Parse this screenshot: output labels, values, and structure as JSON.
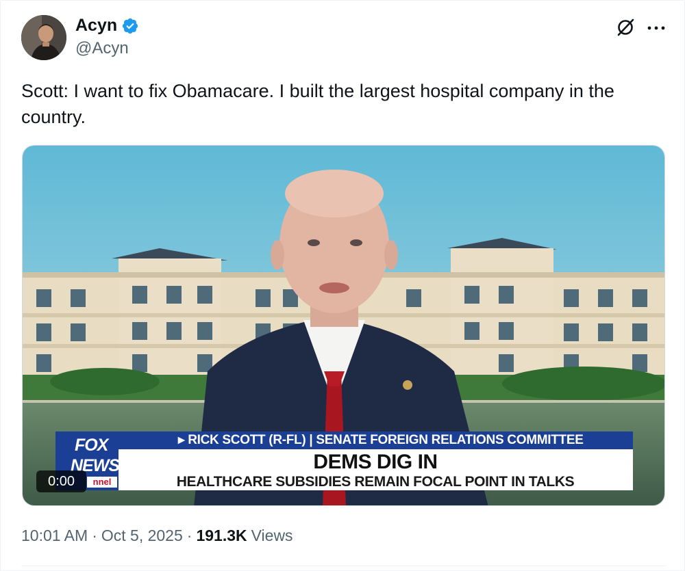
{
  "author": {
    "display_name": "Acyn",
    "handle": "@Acyn",
    "verified": true
  },
  "icons": {
    "verified": "verified-badge-icon",
    "grok": "grok-icon",
    "more": "more-icon"
  },
  "colors": {
    "verified_blue": "#1d9bf0",
    "text_primary": "#0f1419",
    "text_secondary": "#536471",
    "fox_blue": "#1b3f95",
    "fox_red": "#c8102e"
  },
  "tweet": {
    "text": "Scott: I want to fix Obamacare. I built the largest hospital company in the country."
  },
  "video": {
    "chyron_top": "▸ RICK SCOTT (R-FL) | SENATE FOREIGN RELATIONS COMMITTEE",
    "chyron_headline": "DEMS DIG IN",
    "chyron_sub": "HEALTHCARE SUBSIDIES REMAIN FOCAL POINT IN TALKS",
    "logo_line1": "FOX",
    "logo_line2": "NEWS",
    "logo_line3": "nnel",
    "timestamp": "0:00"
  },
  "meta": {
    "time": "10:01 AM",
    "separator": "·",
    "date": "Oct 5, 2025",
    "views_count": "191.3K",
    "views_label": "Views"
  }
}
